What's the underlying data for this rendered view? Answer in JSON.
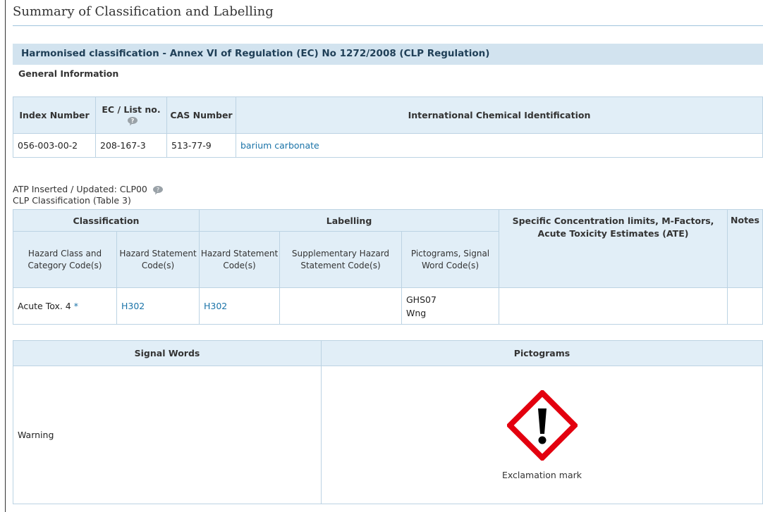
{
  "page": {
    "title": "Summary of Classification and Labelling"
  },
  "section": {
    "title": "Harmonised classification - Annex VI of Regulation (EC) No 1272/2008 (CLP Regulation)"
  },
  "general": {
    "title": "General Information",
    "headers": {
      "index_number": "Index Number",
      "ec_list_no": "EC / List no.",
      "cas_number": "CAS Number",
      "chemical_id": "International Chemical Identification"
    },
    "row": {
      "index_number": "056-003-00-2",
      "ec_list_no": "208-167-3",
      "cas_number": "513-77-9",
      "chemical_id": "barium carbonate"
    }
  },
  "atp": {
    "label": "ATP Inserted / Updated: CLP00"
  },
  "clp": {
    "caption": "CLP Classification (Table 3)",
    "headers": {
      "classification": "Classification",
      "labelling": "Labelling",
      "scl": "Specific Concentration limits, M-Factors, Acute Toxicity Estimates (ATE)",
      "notes": "Notes",
      "hazard_class": "Hazard Class and Category Code(s)",
      "hazard_statement_class": "Hazard Statement Code(s)",
      "hazard_statement_label": "Hazard Statement Code(s)",
      "supplementary": "Supplementary Hazard Statement Code(s)",
      "pictograms": "Pictograms, Signal Word Code(s)"
    },
    "row": {
      "hazard_class": "Acute Tox. 4",
      "hazard_class_marker": "*",
      "hazard_statement_class": "H302",
      "hazard_statement_label": "H302",
      "supplementary": "",
      "pictogram_code": "GHS07",
      "signal_word_code": "Wng",
      "scl": "",
      "notes": ""
    }
  },
  "signal": {
    "headers": {
      "signal_words": "Signal Words",
      "pictograms": "Pictograms"
    },
    "signal_word": "Warning",
    "pictogram_caption": "Exclamation mark",
    "pictogram_icon": "exclamation-mark-icon",
    "pictogram_color": "#e3000f"
  }
}
